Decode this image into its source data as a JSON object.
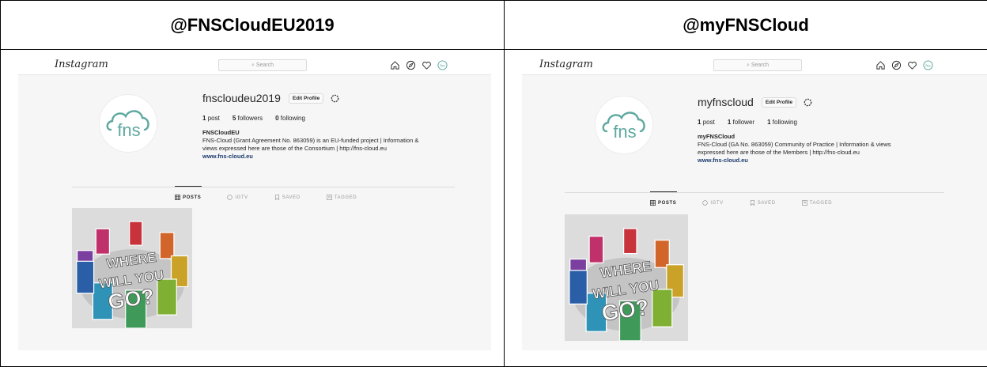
{
  "headers": {
    "left": "@FNSCloudEU2019",
    "right": "@myFNSCloud"
  },
  "profiles": [
    {
      "app_logo": "Instagram",
      "search_placeholder": "Search",
      "nav_icons": [
        "home-icon",
        "compass-icon",
        "heart-icon",
        "profile-avatar-icon"
      ],
      "username": "fnscloudeu2019",
      "edit_profile_label": "Edit Profile",
      "stats": {
        "posts_count": "1",
        "posts_label": "post",
        "followers_count": "5",
        "followers_label": "followers",
        "following_count": "0",
        "following_label": "following"
      },
      "bio_name": "FNSCloudEU",
      "bio_text_1": "FNS-Cloud (Grant Agreement No. 863059) is an EU-funded project | Information &",
      "bio_text_2": "views expressed here are those of the Consortium | http://fns-cloud.eu",
      "bio_link": "www.fns-cloud.eu",
      "tabs": [
        "POSTS",
        "IGTV",
        "SAVED",
        "TAGGED"
      ],
      "active_tab": "POSTS",
      "avatar_text": "fns",
      "post_text": [
        "WHERE",
        "WILL YOU",
        "GO?"
      ]
    },
    {
      "app_logo": "Instagram",
      "search_placeholder": "Search",
      "nav_icons": [
        "home-icon",
        "compass-icon",
        "heart-icon",
        "profile-avatar-icon"
      ],
      "username": "myfnscloud",
      "edit_profile_label": "Edit Profile",
      "stats": {
        "posts_count": "1",
        "posts_label": "post",
        "followers_count": "1",
        "followers_label": "follower",
        "following_count": "1",
        "following_label": "following"
      },
      "bio_name": "myFNSCloud",
      "bio_text_1": "FNS-Cloud (GA No. 863059) Community of Practice | Information & views",
      "bio_text_2": "expressed here are those of the Members | http://fns-cloud.eu",
      "bio_link": "www.fns-cloud.eu",
      "tabs": [
        "POSTS",
        "IGTV",
        "SAVED",
        "TAGGED"
      ],
      "active_tab": "POSTS",
      "avatar_text": "fns",
      "post_text": [
        "WHERE",
        "WILL YOU",
        "GO?"
      ]
    }
  ],
  "colors": {
    "page_bg": "#f6f6f6",
    "avatar_teal": "#5ea8a0",
    "link_blue": "#1c3a6e",
    "door_colors": [
      "#7b3fa0",
      "#c0306b",
      "#c8323a",
      "#d2662a",
      "#c9a227",
      "#7fb034",
      "#3f9a5a",
      "#2f93b8",
      "#2a5fa8"
    ]
  }
}
